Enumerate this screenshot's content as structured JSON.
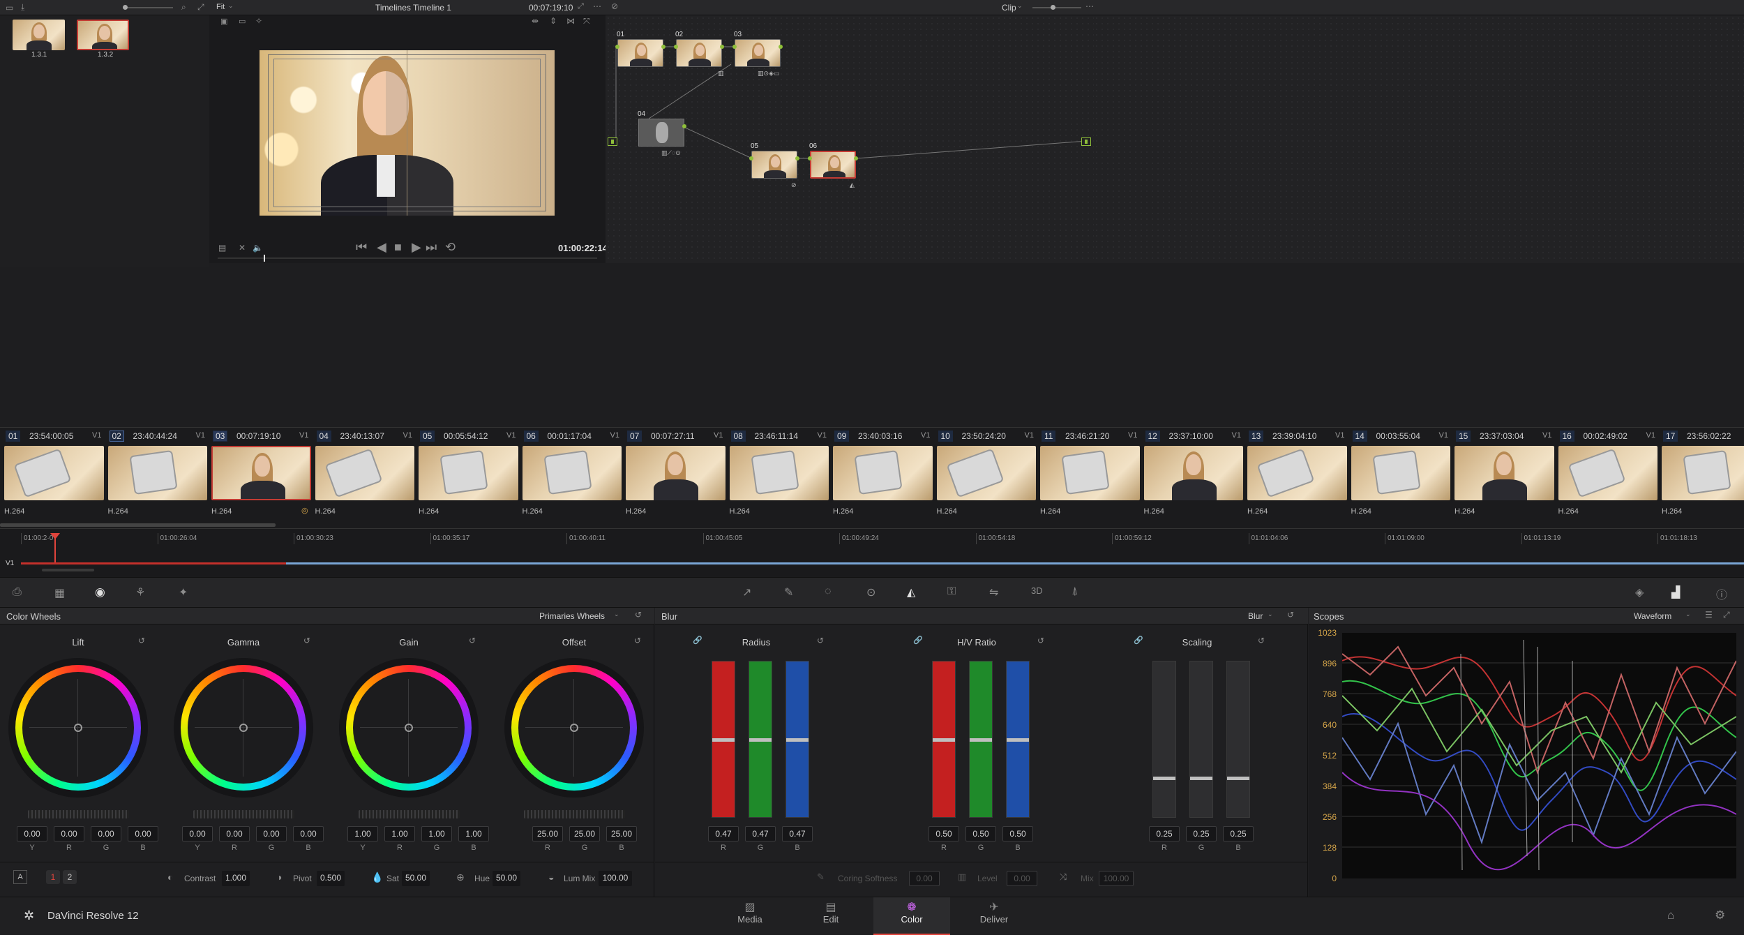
{
  "top_left": {
    "zoom_icon": "search-icon",
    "thumbs": [
      {
        "label": "1.3.1"
      },
      {
        "label": "1.3.2"
      }
    ]
  },
  "viewer": {
    "fit_label": "Fit",
    "timeline_title": "Timelines Timeline 1",
    "timecode_top": "00:07:19:10",
    "timecode": "01:00:22:14"
  },
  "node_editor": {
    "mode_label": "Clip",
    "nodes": [
      {
        "id": "01"
      },
      {
        "id": "02"
      },
      {
        "id": "03"
      },
      {
        "id": "04"
      },
      {
        "id": "05"
      },
      {
        "id": "06"
      }
    ]
  },
  "clips": [
    {
      "num": "01",
      "tc": "23:54:00:05",
      "track": "V1",
      "codec": "H.264"
    },
    {
      "num": "02",
      "tc": "23:40:44:24",
      "track": "V1",
      "codec": "H.264"
    },
    {
      "num": "03",
      "tc": "00:07:19:10",
      "track": "V1",
      "codec": "H.264"
    },
    {
      "num": "04",
      "tc": "23:40:13:07",
      "track": "V1",
      "codec": "H.264"
    },
    {
      "num": "05",
      "tc": "00:05:54:12",
      "track": "V1",
      "codec": "H.264"
    },
    {
      "num": "06",
      "tc": "00:01:17:04",
      "track": "V1",
      "codec": "H.264"
    },
    {
      "num": "07",
      "tc": "00:07:27:11",
      "track": "V1",
      "codec": "H.264"
    },
    {
      "num": "08",
      "tc": "23:46:11:14",
      "track": "V1",
      "codec": "H.264"
    },
    {
      "num": "09",
      "tc": "23:40:03:16",
      "track": "V1",
      "codec": "H.264"
    },
    {
      "num": "10",
      "tc": "23:50:24:20",
      "track": "V1",
      "codec": "H.264"
    },
    {
      "num": "11",
      "tc": "23:46:21:20",
      "track": "V1",
      "codec": "H.264"
    },
    {
      "num": "12",
      "tc": "23:37:10:00",
      "track": "V1",
      "codec": "H.264"
    },
    {
      "num": "13",
      "tc": "23:39:04:10",
      "track": "V1",
      "codec": "H.264"
    },
    {
      "num": "14",
      "tc": "00:03:55:04",
      "track": "V1",
      "codec": "H.264"
    },
    {
      "num": "15",
      "tc": "23:37:03:04",
      "track": "V1",
      "codec": "H.264"
    },
    {
      "num": "16",
      "tc": "00:02:49:02",
      "track": "V1",
      "codec": "H.264"
    },
    {
      "num": "17",
      "tc": "23:56:02:22",
      "track": "",
      "codec": "H.264"
    }
  ],
  "ruler": {
    "track": "V1",
    "ticks": [
      "01:00:2·0",
      "01:00:26:04",
      "01:00:30:23",
      "01:00:35:17",
      "01:00:40:11",
      "01:00:45:05",
      "01:00:49:24",
      "01:00:54:18",
      "01:00:59:12",
      "01:01:04:06",
      "01:01:09:00",
      "01:01:13:19",
      "01:01:18:13"
    ]
  },
  "color_wheels": {
    "title": "Color Wheels",
    "mode": "Primaries Wheels",
    "wheels": [
      {
        "name": "Lift",
        "values": [
          "0.00",
          "0.00",
          "0.00",
          "0.00"
        ],
        "labels": [
          "Y",
          "R",
          "G",
          "B"
        ]
      },
      {
        "name": "Gamma",
        "values": [
          "0.00",
          "0.00",
          "0.00",
          "0.00"
        ],
        "labels": [
          "Y",
          "R",
          "G",
          "B"
        ]
      },
      {
        "name": "Gain",
        "values": [
          "1.00",
          "1.00",
          "1.00",
          "1.00"
        ],
        "labels": [
          "Y",
          "R",
          "G",
          "B"
        ]
      },
      {
        "name": "Offset",
        "values": [
          "25.00",
          "25.00",
          "25.00"
        ],
        "labels": [
          "R",
          "G",
          "B"
        ]
      }
    ],
    "bottom": {
      "a_label": "A",
      "page1": "1",
      "page2": "2",
      "contrast_label": "Contrast",
      "contrast": "1.000",
      "pivot_label": "Pivot",
      "pivot": "0.500",
      "sat_label": "Sat",
      "sat": "50.00",
      "hue_label": "Hue",
      "hue": "50.00",
      "lummix_label": "Lum Mix",
      "lummix": "100.00"
    }
  },
  "blur": {
    "title": "Blur",
    "mode": "Blur",
    "groups": [
      {
        "name": "Radius",
        "values": [
          "0.47",
          "0.47",
          "0.47"
        ],
        "labels": [
          "R",
          "G",
          "B"
        ],
        "level": 0.5
      },
      {
        "name": "H/V Ratio",
        "values": [
          "0.50",
          "0.50",
          "0.50"
        ],
        "labels": [
          "R",
          "G",
          "B"
        ],
        "level": 0.5
      },
      {
        "name": "Scaling",
        "values": [
          "0.25",
          "0.25",
          "0.25"
        ],
        "labels": [
          "R",
          "G",
          "B"
        ],
        "level": 0.25
      }
    ],
    "bottom": {
      "coring_label": "Coring Softness",
      "coring": "0.00",
      "level_label": "Level",
      "level": "0.00",
      "mix_label": "Mix",
      "mix": "100.00"
    }
  },
  "scopes": {
    "title": "Scopes",
    "mode": "Waveform",
    "y_ticks": [
      "1023",
      "896",
      "768",
      "640",
      "512",
      "384",
      "256",
      "128",
      "0"
    ]
  },
  "footer": {
    "app_name": "DaVinci Resolve 12",
    "tabs": [
      "Media",
      "Edit",
      "Color",
      "Deliver"
    ],
    "active": "Color"
  },
  "colors": {
    "accent_red": "#e0443c",
    "node_green": "#8fbf3a",
    "timecode_orange": "#d6a64a"
  }
}
